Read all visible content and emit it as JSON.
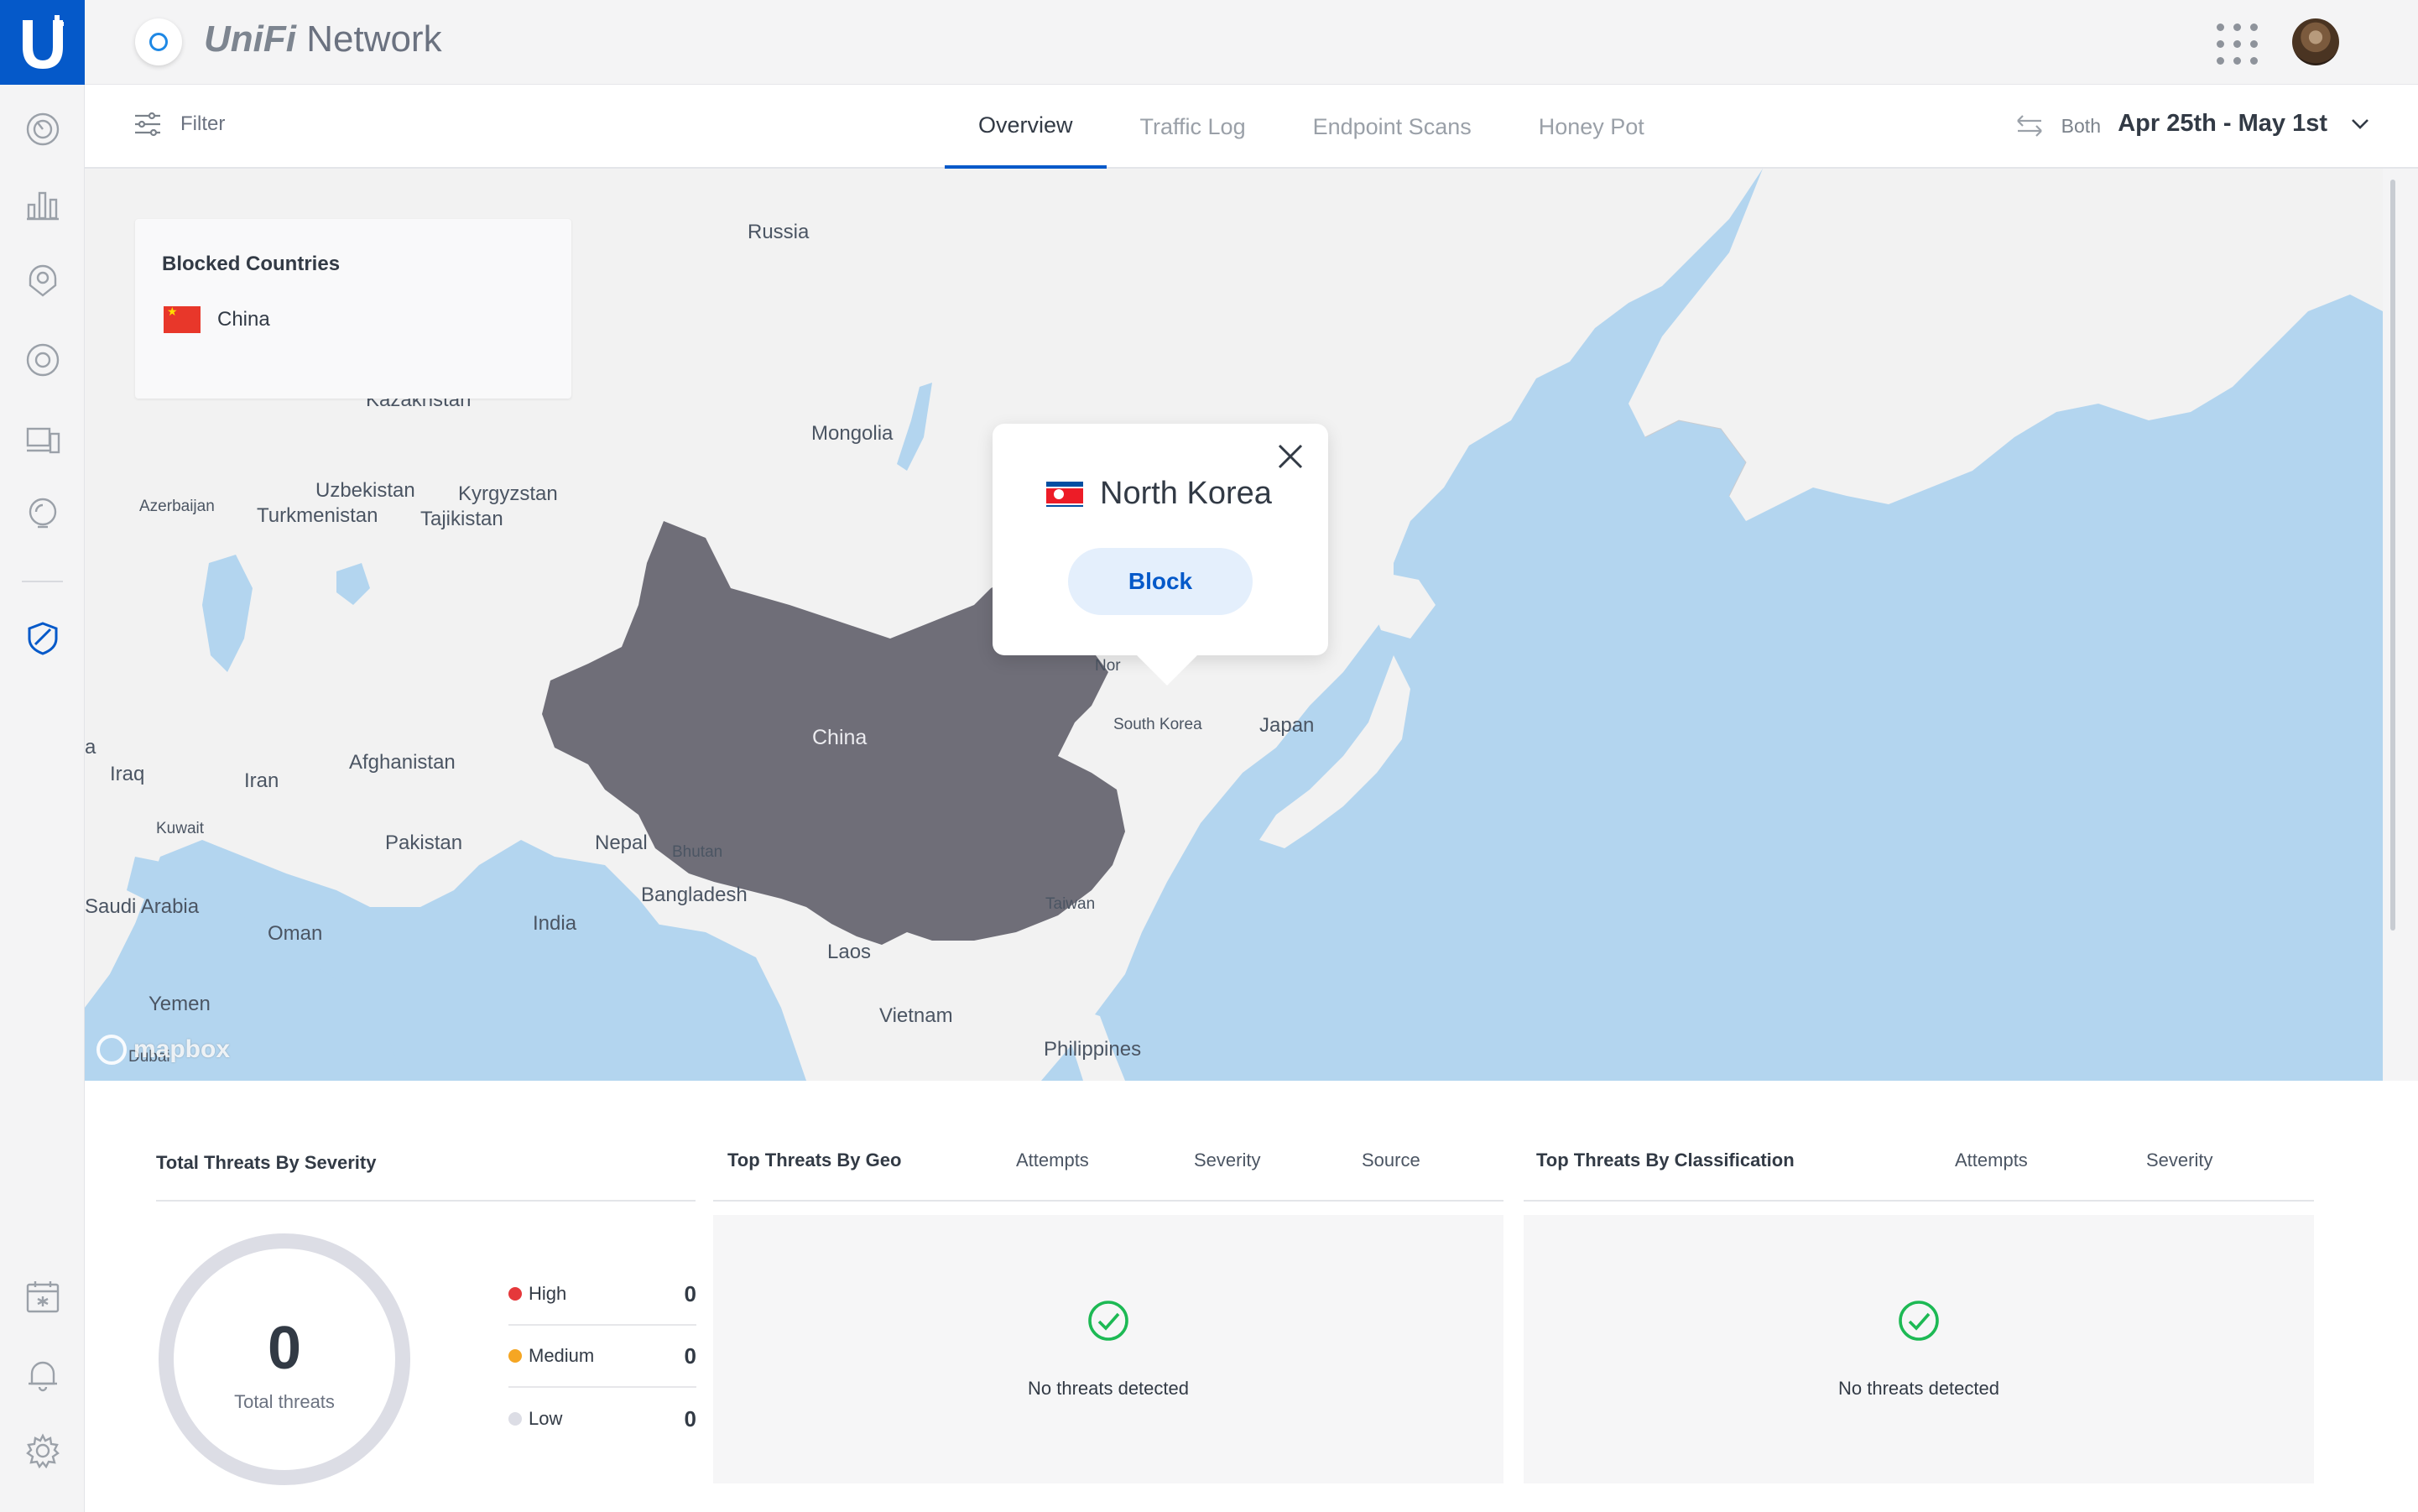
{
  "app": {
    "brand_prefix": "UniFi",
    "brand_suffix": " Network"
  },
  "subnav": {
    "filter_label": "Filter",
    "tabs": [
      {
        "label": "Overview",
        "active": true
      },
      {
        "label": "Traffic Log",
        "active": false
      },
      {
        "label": "Endpoint Scans",
        "active": false
      },
      {
        "label": "Honey Pot",
        "active": false
      }
    ],
    "direction_label": "Both",
    "date_range": "Apr 25th - May 1st"
  },
  "rail": {
    "icons": [
      "dashboard-icon",
      "statistics-icon",
      "map-icon",
      "devices-icon",
      "clients-icon",
      "insights-icon",
      "threat-management-icon",
      "events-icon",
      "alerts-icon",
      "settings-icon"
    ]
  },
  "map": {
    "blocked_countries": {
      "title": "Blocked Countries",
      "items": [
        {
          "name": "China"
        }
      ]
    },
    "popup": {
      "country": "North Korea",
      "action_label": "Block"
    },
    "attribution": "mapbox",
    "labels": {
      "russia": "Russia",
      "kazakhstan": "Kazakhstan",
      "mongolia": "Mongolia",
      "uzbekistan": "Uzbekistan",
      "kyrgyzstan": "Kyrgyzstan",
      "azerbaijan": "Azerbaijan",
      "turkmenistan": "Turkmenistan",
      "tajikistan": "Tajikistan",
      "china": "China",
      "iraq": "Iraq",
      "iran": "Iran",
      "afghanistan": "Afghanistan",
      "kuwait": "Kuwait",
      "pakistan": "Pakistan",
      "nepal": "Nepal",
      "bhutan": "Bhutan",
      "bangladesh": "Bangladesh",
      "india": "India",
      "saudi_arabia": "Saudi Arabia",
      "oman": "Oman",
      "yemen": "Yemen",
      "laos": "Laos",
      "vietnam": "Vietnam",
      "philippines": "Philippines",
      "taiwan": "Taiwan",
      "south_korea": "South Korea",
      "japan": "Japan",
      "nor": "Nor",
      "a": "a",
      "dubai": "Dubai"
    }
  },
  "stats": {
    "severity": {
      "title": "Total Threats By Severity",
      "total": "0",
      "total_label": "Total threats",
      "rows": [
        {
          "label": "High",
          "value": "0",
          "color": "#e5383b"
        },
        {
          "label": "Medium",
          "value": "0",
          "color": "#f5a623"
        },
        {
          "label": "Low",
          "value": "0",
          "color": "#dcdde5"
        }
      ]
    },
    "geo": {
      "title": "Top Threats By Geo",
      "columns": [
        "Attempts",
        "Severity",
        "Source"
      ],
      "empty_message": "No threats detected"
    },
    "classification": {
      "title": "Top Threats By Classification",
      "columns": [
        "Attempts",
        "Severity"
      ],
      "empty_message": "No threats detected"
    }
  },
  "colors": {
    "accent": "#0559c9",
    "ocean": "#b3d5ef",
    "land": "#f2f2f2",
    "blocked_land": "#6f6e78",
    "success": "#1db954"
  }
}
